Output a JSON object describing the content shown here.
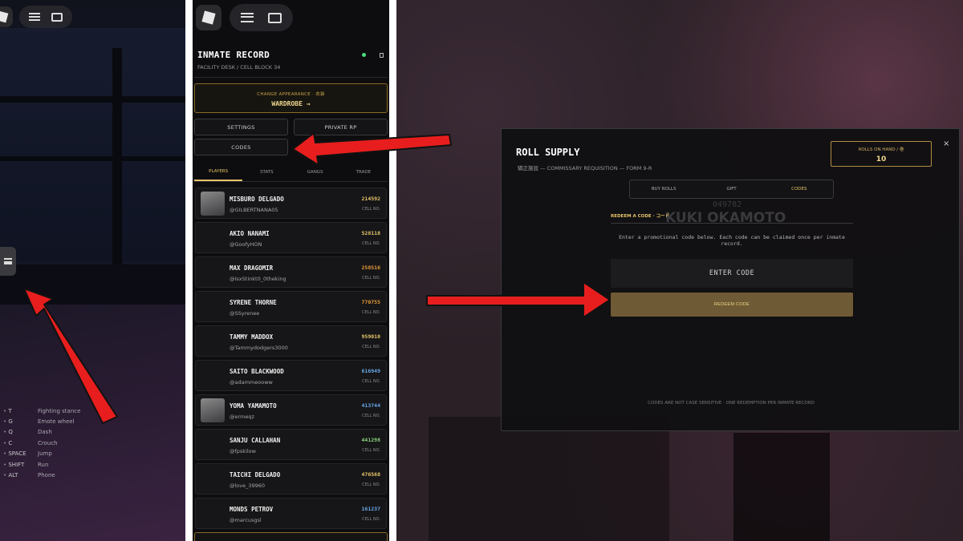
{
  "panel_left": {
    "keybinds": [
      {
        "key": "T",
        "action": "Fighting stance"
      },
      {
        "key": "G",
        "action": "Emote wheel"
      },
      {
        "key": "Q",
        "action": "Dash"
      },
      {
        "key": "C",
        "action": "Crouch"
      },
      {
        "key": "SPACE",
        "action": "Jump"
      },
      {
        "key": "SHIFT",
        "action": "Run"
      },
      {
        "key": "ALT",
        "action": "Phone"
      }
    ]
  },
  "panel_menu": {
    "title": "INMATE RECORD",
    "subtitle": "FACILITY DESK / CELL BLOCK 34",
    "wardrobe": {
      "label": "CHANGE APPEARANCE · 衣装",
      "button": "WARDROBE →"
    },
    "buttons": {
      "settings": "SETTINGS",
      "private_rp": "PRIVATE RP",
      "codes": "CODES"
    },
    "tabs": [
      "PLAYERS",
      "STATS",
      "GANGS",
      "TRADE"
    ],
    "cell_label": "CELL NO.",
    "players": [
      {
        "name": "MISBURO DELGADO",
        "handle": "@GILBERTNANA05",
        "number": "214592",
        "color": "#e8c56a"
      },
      {
        "name": "AKIO NANAMI",
        "handle": "@GoofyHON",
        "number": "528118",
        "color": "#e8c56a"
      },
      {
        "name": "MAX DRAGOMIR",
        "handle": "@IsxStinkt0_0theking",
        "number": "258516",
        "color": "#e89a3a"
      },
      {
        "name": "SYRENE THORNE",
        "handle": "@SSyrenee",
        "number": "770755",
        "color": "#e89a3a"
      },
      {
        "name": "TAMMY MADDOX",
        "handle": "@Tammydodgers3000",
        "number": "959010",
        "color": "#e8c56a"
      },
      {
        "name": "SAITO BLACKWOOD",
        "handle": "@adammeooww",
        "number": "616949",
        "color": "#6aa8e8"
      },
      {
        "name": "YOMA YAMAMOTO",
        "handle": "@ermeqz",
        "number": "413744",
        "color": "#6aa8e8"
      },
      {
        "name": "SANJU CALLAHAN",
        "handle": "@fpskilow",
        "number": "441298",
        "color": "#8ad07a"
      },
      {
        "name": "TAICHI DELGADO",
        "handle": "@love_39960",
        "number": "476568",
        "color": "#e8c56a"
      },
      {
        "name": "MONDS PETROV",
        "handle": "@marcusgsl",
        "number": "161237",
        "color": "#6aa8e8"
      }
    ]
  },
  "modal": {
    "title": "ROLL SUPPLY",
    "subtitle": "矯正施設 — COMMISSARY REQUISITION — FORM 9-R",
    "rolls_label": "ROLLS ON HAND / 巻",
    "rolls_value": "10",
    "close": "×",
    "tabs": [
      "BUY ROLLS",
      "GIFT",
      "CODES"
    ],
    "ghost_number": "049782",
    "ghost_name": "KUKI OKAMOTO",
    "section_label": "REDEEM A CODE · コード",
    "description": "Enter a promotional code below. Each code can be claimed once per inmate record.",
    "input_placeholder": "ENTER CODE",
    "redeem_button": "REDEEM CODE",
    "footer": "CODES ARE NOT CASE SENSITIVE · ONE REDEMPTION PER INMATE RECORD"
  },
  "colors": {
    "accent_gold": "#e8c56a",
    "arrow_red": "#e81e1e"
  },
  "icons": [
    "roblox-logo-icon",
    "hamburger-menu-icon",
    "chat-icon",
    "close-icon",
    "arrow-annotation-icon"
  ]
}
